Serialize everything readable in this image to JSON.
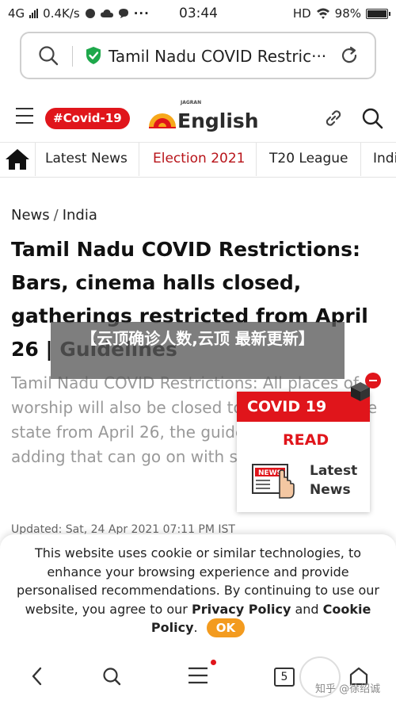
{
  "status_bar": {
    "network": "4G",
    "speed": "0.4K/s",
    "time": "03:44",
    "hd": "HD",
    "battery": "98%"
  },
  "url_bar": {
    "url_text": "Tamil Nadu COVID Restric···",
    "icons": [
      "search-icon",
      "shield-check-icon",
      "refresh-icon"
    ]
  },
  "header": {
    "covid_badge": "#Covid-19",
    "logo_small": "JAGRAN",
    "logo_word": "English"
  },
  "nav": {
    "tabs": [
      {
        "label": "Latest News"
      },
      {
        "label": "Election 2021"
      },
      {
        "label": "T20 League"
      },
      {
        "label": "Indi"
      }
    ],
    "active_color": "#b8141a"
  },
  "article": {
    "breadcrumb": [
      "News",
      "India"
    ],
    "headline": "Tamil Nadu COVID Restrictions: Bars, cinema halls closed, gatherings restricted from April 26 | Guidelines",
    "summary": "Tamil Nadu COVID Restrictions: All places of worship will also be closed to the public in the state from April 26, the guidelines stated, adding that can go on with staff alone.",
    "updated": "Updated: Sat, 24 Apr 2021 07:11 PM IST"
  },
  "overlay": {
    "text": "【云顶确诊人数,云顶 最新更新】"
  },
  "ad": {
    "title": "COVID 19",
    "read": "READ",
    "latest": "Latest",
    "news": "News",
    "news_icon_text": "NEWS"
  },
  "cookie": {
    "text_before": "This website uses cookie or similar technologies, to enhance your browsing experience and provide personalised recommendations. By continuing to use our website, you agree to our ",
    "privacy": "Privacy Policy",
    "and": " and ",
    "cookie_policy": "Cookie Policy",
    "period": ".",
    "ok": "OK"
  },
  "bottom_bar": {
    "tab_count": "5",
    "watermark": "知乎 @徐绍诚"
  },
  "colors": {
    "brand_red": "#e0151b",
    "ok_orange": "#f39b1f"
  }
}
